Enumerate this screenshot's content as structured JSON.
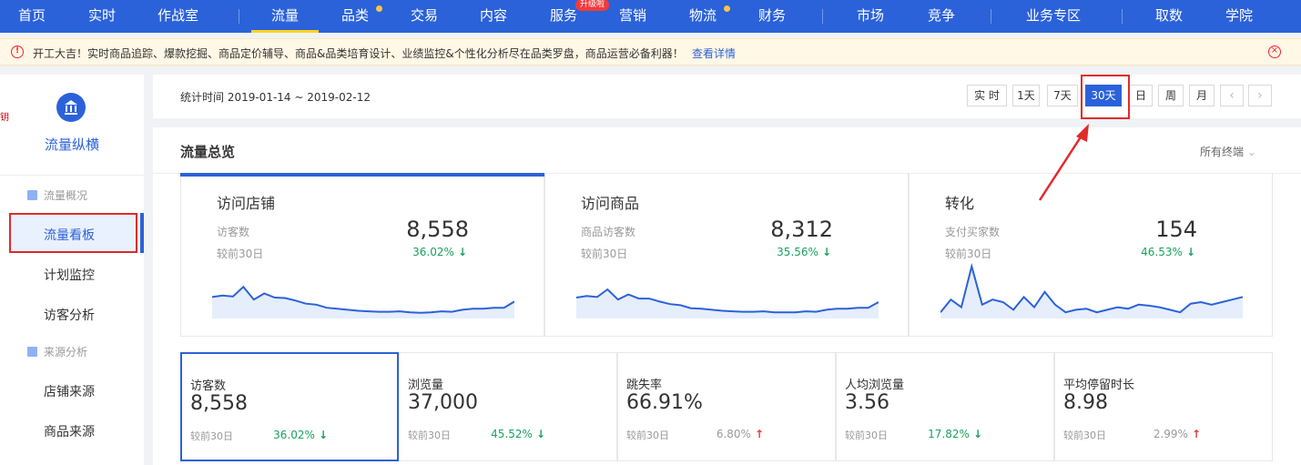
{
  "topnav": {
    "items": [
      {
        "label": "首页"
      },
      {
        "label": "实时"
      },
      {
        "label": "作战室"
      },
      {
        "label": "流量"
      },
      {
        "label": "品类"
      },
      {
        "label": "交易"
      },
      {
        "label": "内容"
      },
      {
        "label": "服务"
      },
      {
        "label": "营销"
      },
      {
        "label": "物流"
      },
      {
        "label": "财务"
      },
      {
        "label": "市场"
      },
      {
        "label": "竞争"
      },
      {
        "label": "业务专区"
      },
      {
        "label": "取数"
      },
      {
        "label": "学院"
      }
    ],
    "upgrade_badge": "升级啦",
    "active": "流量"
  },
  "notice": {
    "text": "开工大吉！实时商品追踪、爆款挖掘、商品定价辅导、商品&品类培育设计、业绩监控&个性化分析尽在品类罗盘，商品运营必备利器！",
    "link": "查看详情"
  },
  "sidebar": {
    "title": "流量纵横",
    "edge_text": "钥",
    "groups": [
      {
        "label": "流量概况",
        "items": [
          "流量看板",
          "计划监控",
          "访客分析"
        ]
      },
      {
        "label": "来源分析",
        "items": [
          "店铺来源",
          "商品来源"
        ]
      }
    ]
  },
  "timebar": {
    "label": "统计时间 2019-01-14 ~ 2019-02-12",
    "buttons": [
      "实 时",
      "1天",
      "7天",
      "30天",
      "日",
      "周",
      "月"
    ],
    "active": "30天",
    "prev": "‹",
    "next": "›"
  },
  "panel": {
    "title": "流量总览",
    "terminal": "所有终端",
    "cards": [
      {
        "title": "访问店铺",
        "label": "访客数",
        "value": "8,558",
        "cmp": "较前30日",
        "pct": "36.02%",
        "trend": "down",
        "spark": [
          0.35,
          0.38,
          0.36,
          0.55,
          0.3,
          0.42,
          0.34,
          0.33,
          0.28,
          0.22,
          0.2,
          0.14,
          0.12,
          0.1,
          0.08,
          0.07,
          0.06,
          0.06,
          0.07,
          0.05,
          0.04,
          0.05,
          0.07,
          0.06,
          0.1,
          0.12,
          0.12,
          0.14,
          0.14,
          0.26
        ]
      },
      {
        "title": "访问商品",
        "label": "商品访客数",
        "value": "8,312",
        "cmp": "较前30日",
        "pct": "35.56%",
        "trend": "down",
        "spark": [
          0.34,
          0.37,
          0.35,
          0.5,
          0.3,
          0.4,
          0.32,
          0.32,
          0.26,
          0.21,
          0.19,
          0.13,
          0.12,
          0.1,
          0.08,
          0.07,
          0.06,
          0.06,
          0.07,
          0.05,
          0.05,
          0.05,
          0.07,
          0.06,
          0.1,
          0.12,
          0.12,
          0.14,
          0.14,
          0.25
        ]
      },
      {
        "title": "转化",
        "label": "支付买家数",
        "value": "154",
        "cmp": "较前30日",
        "pct": "46.53%",
        "trend": "down",
        "spark": [
          0.05,
          0.3,
          0.15,
          0.95,
          0.2,
          0.3,
          0.25,
          0.1,
          0.35,
          0.15,
          0.45,
          0.2,
          0.05,
          0.1,
          0.12,
          0.05,
          0.1,
          0.15,
          0.12,
          0.2,
          0.18,
          0.15,
          0.1,
          0.05,
          0.22,
          0.25,
          0.2,
          0.25,
          0.3,
          0.35
        ]
      }
    ],
    "metrics": [
      {
        "label": "访客数",
        "value": "8,558",
        "cmp": "较前30日",
        "pct": "36.02%",
        "trend": "down"
      },
      {
        "label": "浏览量",
        "value": "37,000",
        "cmp": "较前30日",
        "pct": "45.52%",
        "trend": "down"
      },
      {
        "label": "跳失率",
        "value": "66.91%",
        "cmp": "较前30日",
        "pct": "6.80%",
        "trend": "up"
      },
      {
        "label": "人均浏览量",
        "value": "3.56",
        "cmp": "较前30日",
        "pct": "17.82%",
        "trend": "down"
      },
      {
        "label": "平均停留时长",
        "value": "8.98",
        "cmp": "较前30日",
        "pct": "2.99%",
        "trend": "up"
      }
    ]
  },
  "colors": {
    "brand": "#2b62d9",
    "down": "#1aa15f",
    "up": "#e23b3b",
    "annotation": "#e12a2a"
  }
}
